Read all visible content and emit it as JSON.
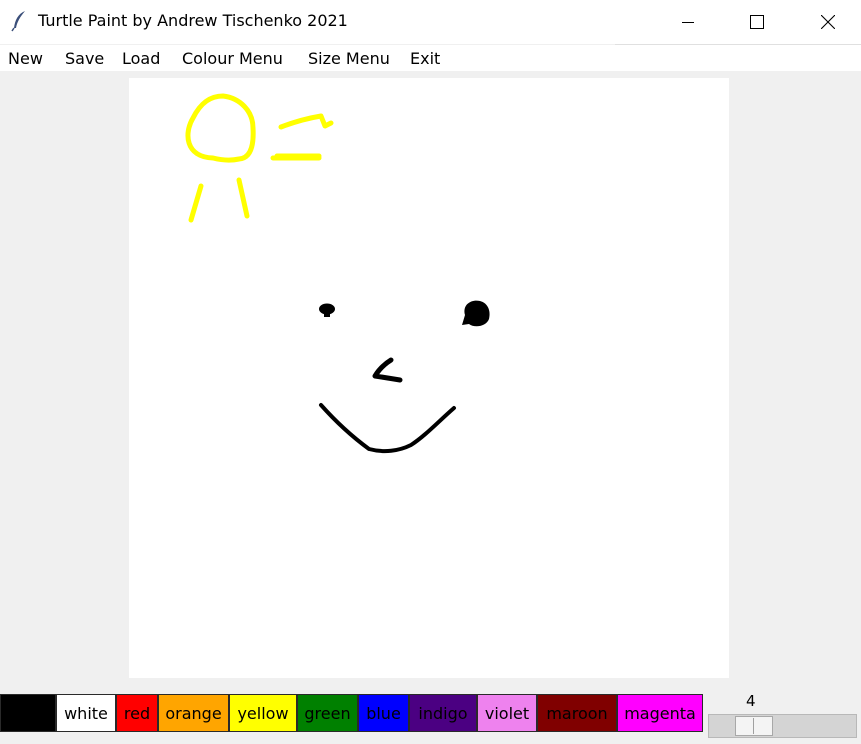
{
  "window": {
    "title": "Turtle Paint by Andrew Tischenko 2021",
    "app_icon": "feather-icon",
    "controls": [
      "minimize-icon",
      "maximize-icon",
      "close-icon"
    ]
  },
  "menu": {
    "items": [
      {
        "label": "New"
      },
      {
        "label": "Save"
      },
      {
        "label": "Load"
      },
      {
        "label": "Colour Menu"
      },
      {
        "label": "Size Menu"
      },
      {
        "label": "Exit"
      }
    ]
  },
  "canvas": {
    "background": "#ffffff",
    "drawing_colors": [
      "#ffff00",
      "#000000"
    ]
  },
  "palette": {
    "swatches": [
      {
        "label": "",
        "color": "#000000"
      },
      {
        "label": "white",
        "color": "#ffffff"
      },
      {
        "label": "red",
        "color": "#ff0000"
      },
      {
        "label": "orange",
        "color": "#ffa500"
      },
      {
        "label": "yellow",
        "color": "#ffff00"
      },
      {
        "label": "green",
        "color": "#008000"
      },
      {
        "label": "blue",
        "color": "#0000ff"
      },
      {
        "label": "indigo",
        "color": "#4b0082"
      },
      {
        "label": "violet",
        "color": "#ee82ee"
      },
      {
        "label": "maroon",
        "color": "#800000"
      },
      {
        "label": "magenta",
        "color": "#ff00ff"
      }
    ]
  },
  "size_slider": {
    "value": "4"
  }
}
